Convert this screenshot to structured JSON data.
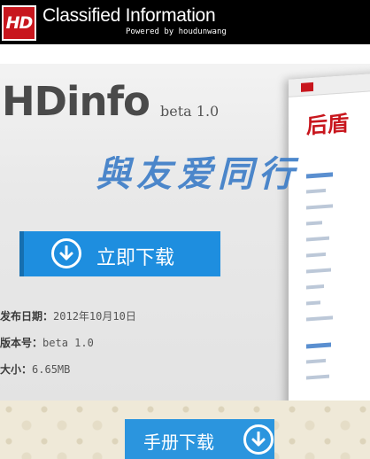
{
  "header": {
    "logo_text": "HD",
    "title": "Classified Information",
    "subtitle": "Powered by houdunwang"
  },
  "hero": {
    "app_name": "HDinfo",
    "version_tag": "beta 1.0",
    "slogan": "與友爱同行",
    "preview_brand": "后盾"
  },
  "download_button": {
    "label": "立即下载",
    "icon": "download-arrow-icon"
  },
  "info": [
    {
      "key": "发布日期：",
      "value": "2012年10月10日"
    },
    {
      "key": "版本号：",
      "value": "beta 1.0"
    },
    {
      "key": "大小：",
      "value": "6.65MB"
    }
  ],
  "manual_button": {
    "label": "手册下载",
    "icon": "download-arrow-icon"
  },
  "colors": {
    "header_bg": "#000000",
    "logo_red": "#c8161d",
    "button_blue": "#1e8edf",
    "slogan_blue": "#3e7ec8"
  }
}
